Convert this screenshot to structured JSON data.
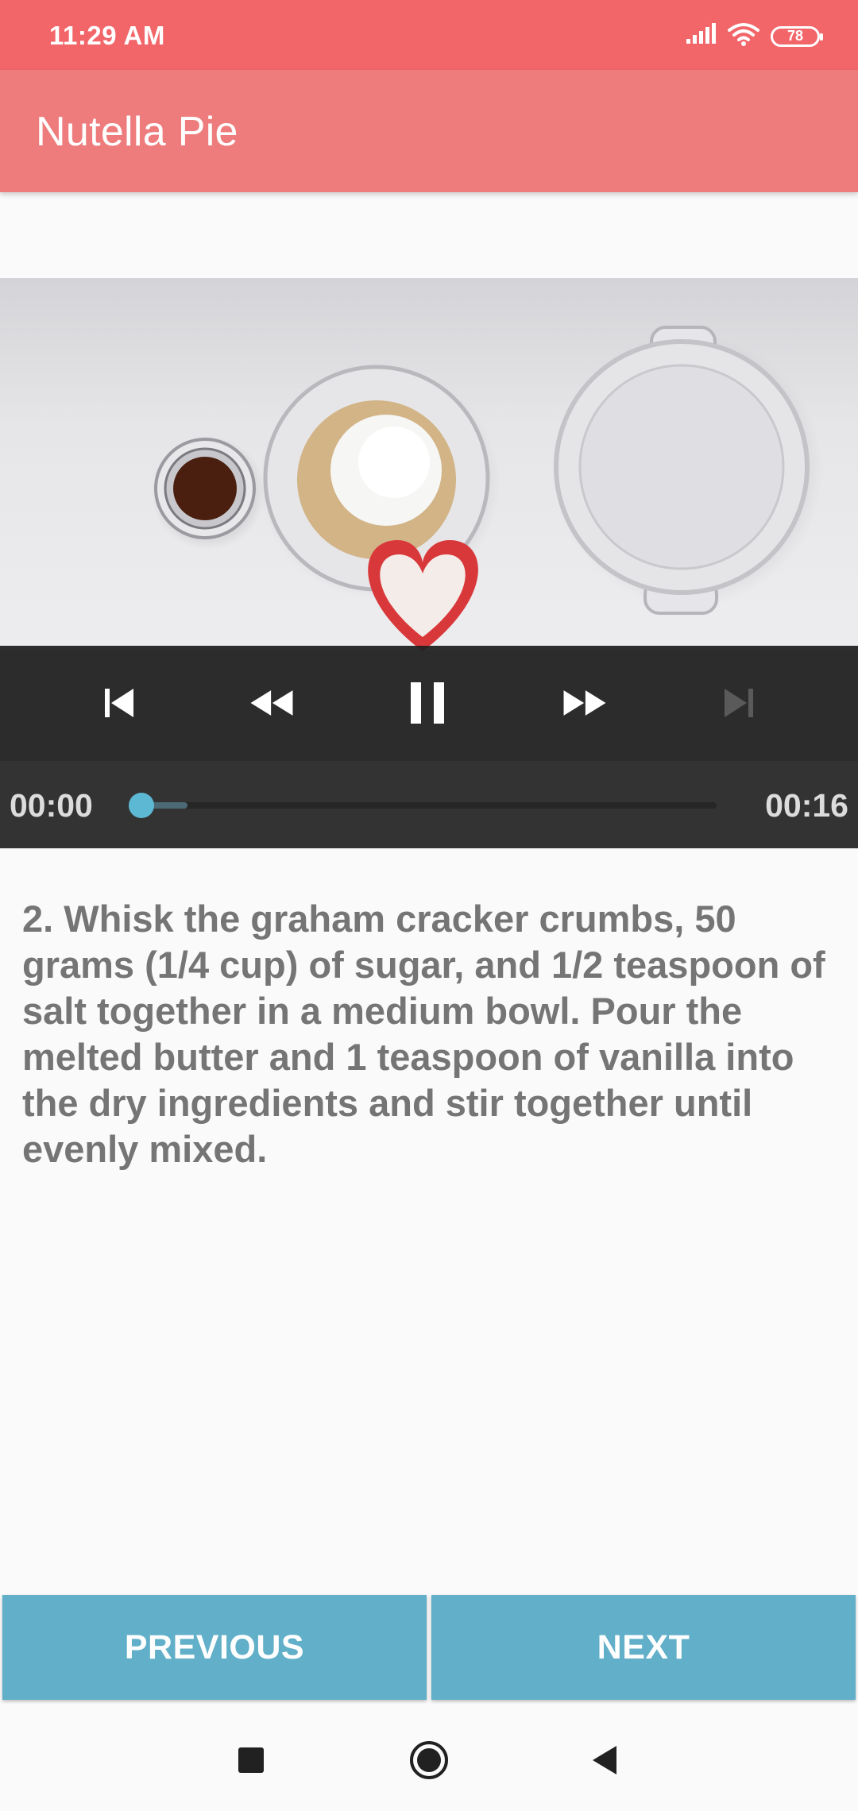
{
  "status_bar": {
    "time": "11:29 AM",
    "battery": "78",
    "icons": [
      "signal-icon",
      "wifi-icon",
      "battery-icon"
    ]
  },
  "app_bar": {
    "title": "Nutella Pie"
  },
  "player": {
    "controls": [
      "skip-previous-icon",
      "rewind-icon",
      "pause-icon",
      "fast-forward-icon",
      "skip-next-icon"
    ],
    "current_time": "00:00",
    "duration": "00:16",
    "progress_fraction": 0.0,
    "buffered_fraction": 0.08,
    "colors": {
      "thumb": "#5db8d3",
      "controls_bg": "#1e1e1e",
      "progress_bg": "#333333"
    }
  },
  "step": {
    "description": "2. Whisk the graham cracker crumbs, 50 grams (1/4 cup) of sugar, and 1/2 teaspoon of salt together in a medium bowl. Pour the melted butter and 1 teaspoon of vanilla into the dry ingredients and stir together until evenly mixed."
  },
  "buttons": {
    "previous": "PREVIOUS",
    "next": "NEXT"
  },
  "system_nav": {
    "icons": [
      "recents-icon",
      "home-icon",
      "back-icon"
    ]
  },
  "colors": {
    "status_bar": "#f2666a",
    "app_bar": "#ee7c7c",
    "button": "#61afc8",
    "text": "#757575"
  }
}
